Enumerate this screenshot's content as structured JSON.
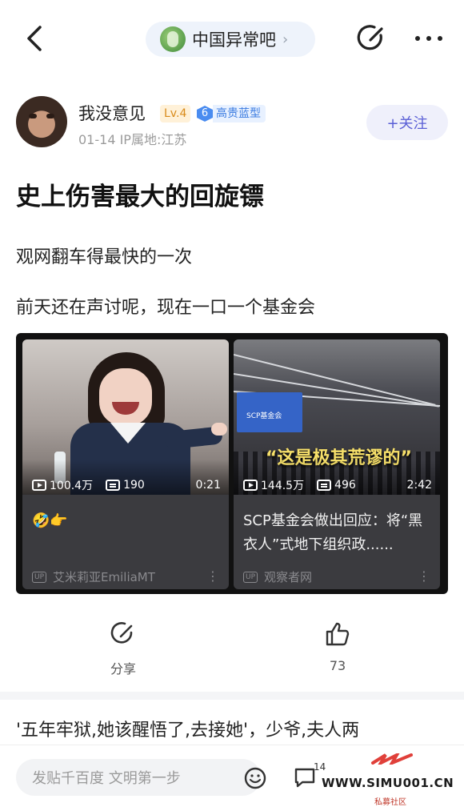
{
  "topbar": {
    "forum_name": "中国异常吧"
  },
  "author": {
    "name": "我没意见",
    "level": "Lv.4",
    "honor_level": "6",
    "honor_title": "高贵蓝型",
    "meta": "01-14   IP属地:江苏",
    "follow_label": "+关注"
  },
  "post": {
    "title": "史上伤害最大的回旋镖",
    "line1": "观网翻车得最快的一次",
    "line2": "前天还在声讨呢，现在一口一个基金会"
  },
  "videos": [
    {
      "views": "100.4万",
      "danmaku": "190",
      "duration": "0:21",
      "caption": "🤣👉",
      "source": "艾米莉亚EmiliaMT"
    },
    {
      "views": "144.5万",
      "danmaku": "496",
      "duration": "2:42",
      "caption": "SCP基金会做出回应：将“黑衣人”式地下组织政......",
      "source": "观察者网",
      "overlay_text": "“这是极其荒谬的”",
      "screen_text": "SCP基金会"
    }
  ],
  "actions": {
    "share_label": "分享",
    "like_count": "73"
  },
  "teaser": "'五年牢狱,她该醒悟了,去接她'，少爷,夫人两",
  "bottombar": {
    "comment_placeholder": "发贴千百度 文明第一步",
    "reply_count": "14"
  },
  "watermark": {
    "text": "WWW.SIMU001.CN",
    "sub": "私募社区"
  },
  "colors": {
    "accent_purple": "#5a5fd6",
    "level_orange": "#d88a1a",
    "honor_blue": "#4a8cf0"
  }
}
